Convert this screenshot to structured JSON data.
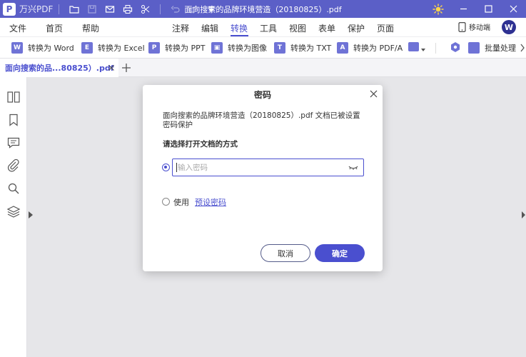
{
  "app": {
    "logo_letter": "P",
    "name": "万兴PDF",
    "window_title": "面向搜索的品牌环境营造（20180825）.pdf",
    "accent_color": "#5b5fc7"
  },
  "quick_access": [
    "folder-icon",
    "save-icon",
    "mail-icon",
    "print-icon",
    "cut-icon",
    "undo-icon",
    "redo-icon",
    "customize-icon"
  ],
  "menu": {
    "left": [
      "文件",
      "首页",
      "帮助"
    ],
    "center": [
      "注释",
      "编辑",
      "转换",
      "工具",
      "视图",
      "表单",
      "保护",
      "页面"
    ],
    "active": "转换",
    "mobile_label": "移动端",
    "avatar_letter": "W"
  },
  "toolbar": {
    "items": [
      {
        "label": "转换为 Word",
        "icon": "W"
      },
      {
        "label": "转换为 Excel",
        "icon": "E"
      },
      {
        "label": "转换为 PPT",
        "icon": "P"
      },
      {
        "label": "转换为图像",
        "icon": "▣"
      },
      {
        "label": "转换为 TXT",
        "icon": "T"
      },
      {
        "label": "转换为 PDF/A",
        "icon": "A"
      }
    ],
    "batch_label": "批量处理"
  },
  "tab": {
    "label": "面向搜索的品...80825）.pdf"
  },
  "sidebar_icons": [
    "thumbnails-icon",
    "bookmark-icon",
    "comment-icon",
    "attachment-icon",
    "search-icon",
    "layers-icon"
  ],
  "dialog": {
    "title": "密码",
    "message": "面向搜索的品牌环境营造（20180825）.pdf 文档已被设置密码保护",
    "subtitle": "请选择打开文档的方式",
    "password_placeholder": "输入密码",
    "use_label": "使用",
    "use_link": "预设密码",
    "cancel_label": "取消",
    "ok_label": "确定"
  }
}
